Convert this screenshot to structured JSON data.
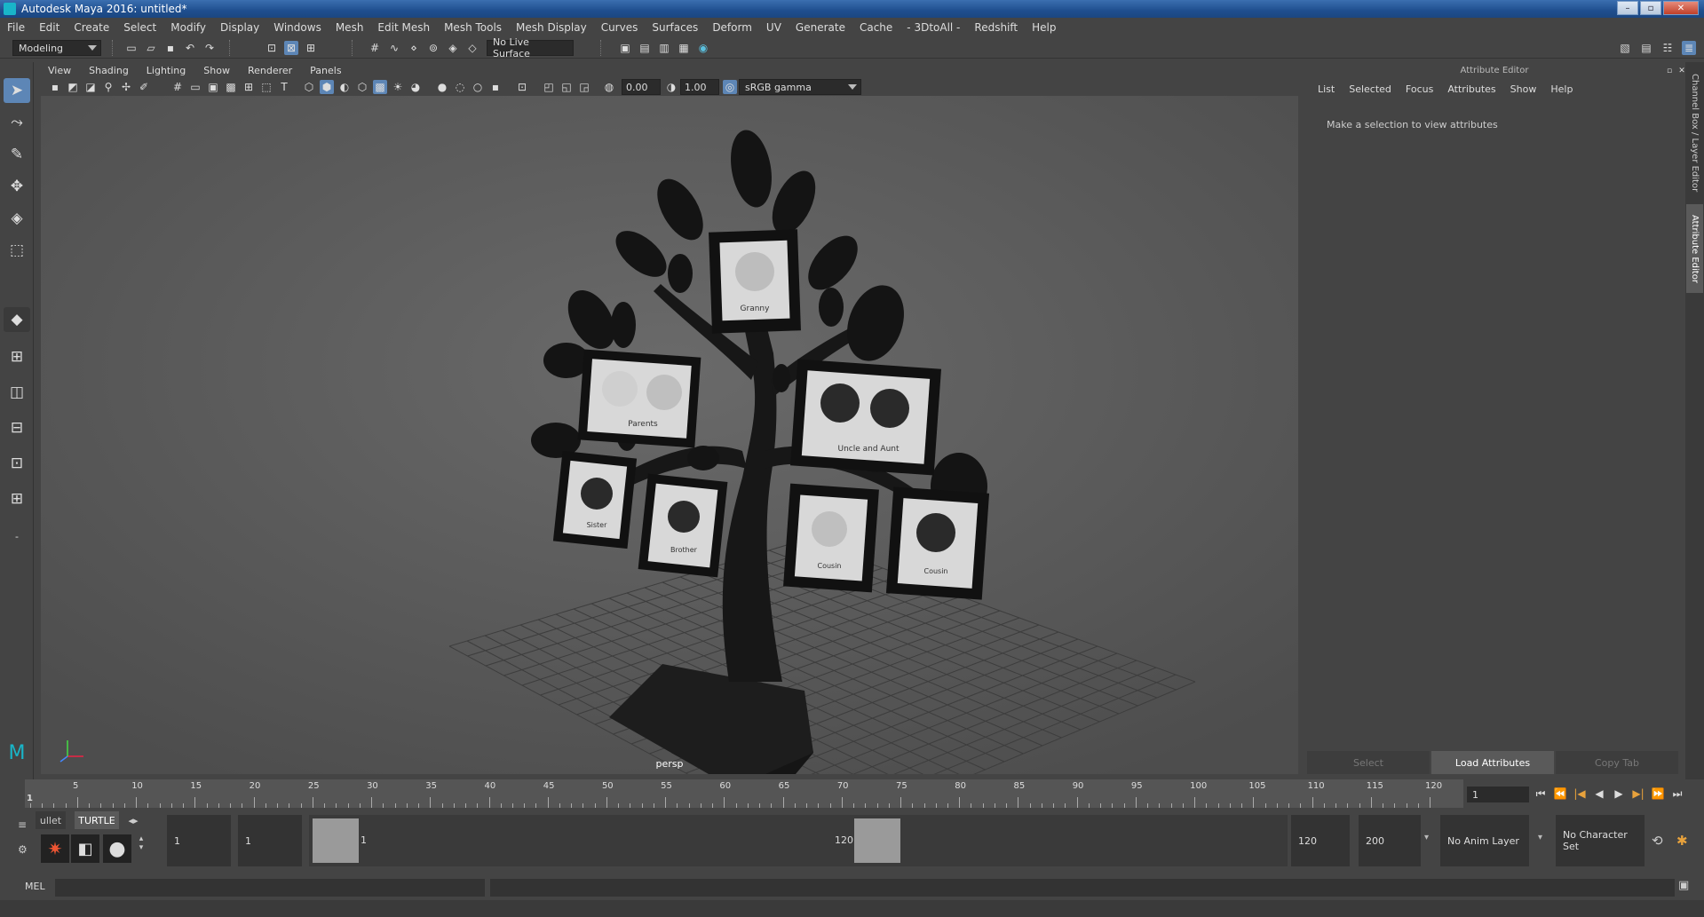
{
  "window": {
    "title": "Autodesk Maya 2016: untitled*",
    "min": "–",
    "max": "▫",
    "close": "✕"
  },
  "menus": [
    "File",
    "Edit",
    "Create",
    "Select",
    "Modify",
    "Display",
    "Windows",
    "Mesh",
    "Edit Mesh",
    "Mesh Tools",
    "Mesh Display",
    "Curves",
    "Surfaces",
    "Deform",
    "UV",
    "Generate",
    "Cache",
    "- 3DtoAll -",
    "Redshift",
    "Help"
  ],
  "statusline": {
    "mode": "Modeling",
    "live_surface": "No Live Surface"
  },
  "viewport": {
    "menus": [
      "View",
      "Shading",
      "Lighting",
      "Show",
      "Renderer",
      "Panels"
    ],
    "exposure": "0.00",
    "gamma": "1.00",
    "colorspace": "sRGB gamma",
    "camera": "persp",
    "frames": [
      {
        "label": "Granny"
      },
      {
        "label": "Parents"
      },
      {
        "label": "Uncle and Aunt"
      },
      {
        "label": "Sister"
      },
      {
        "label": "Brother"
      },
      {
        "label": "Cousin"
      },
      {
        "label": "Cousin"
      }
    ]
  },
  "attribute_editor": {
    "title": "Attribute Editor",
    "menus": [
      "List",
      "Selected",
      "Focus",
      "Attributes",
      "Show",
      "Help"
    ],
    "message": "Make a selection to view attributes",
    "buttons": {
      "select": "Select",
      "load": "Load Attributes",
      "copy": "Copy Tab"
    }
  },
  "side_tabs": {
    "channel_box": "Channel Box / Layer Editor",
    "attribute_editor": "Attribute Editor"
  },
  "timeline": {
    "ticks": [
      "5",
      "10",
      "15",
      "20",
      "25",
      "30",
      "35",
      "40",
      "45",
      "50",
      "55",
      "60",
      "65",
      "70",
      "75",
      "80",
      "85",
      "90",
      "95",
      "100",
      "105",
      "110",
      "115",
      "120"
    ],
    "start_label": "1",
    "end_label": "120",
    "current_frame": "1",
    "play_icons": [
      "⏮",
      "⏪",
      "|◀",
      "◀",
      "▶",
      "▶|",
      "⏩",
      "⏭"
    ]
  },
  "range": {
    "start": "1",
    "playback_start": "1",
    "slider_start": "1",
    "slider_end": "120",
    "playback_end": "120",
    "end": "200",
    "anim_layer": "No Anim Layer",
    "character_set": "No Character Set"
  },
  "shelf": {
    "tabs": [
      "ullet",
      "TURTLE"
    ]
  },
  "mel": {
    "label": "MEL"
  }
}
